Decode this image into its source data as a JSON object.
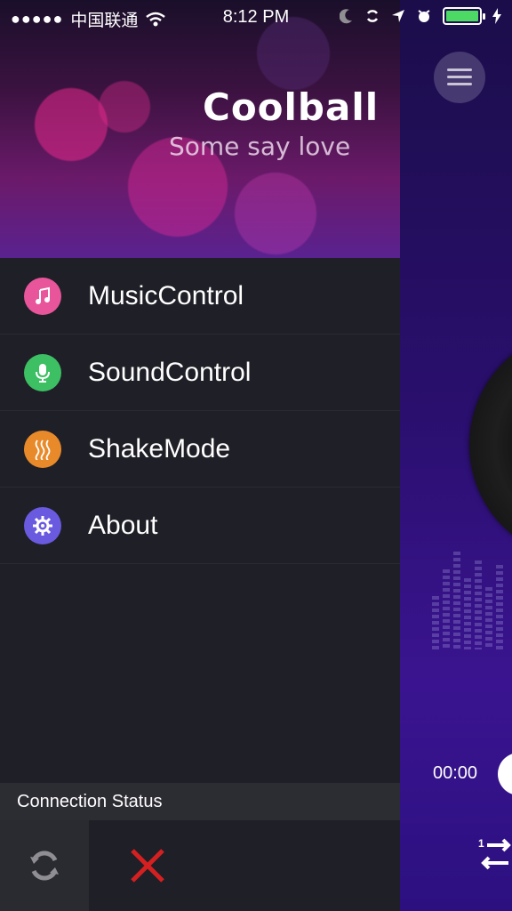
{
  "status_bar": {
    "signal_dots": "●●●●●",
    "carrier": "中国联通",
    "time": "8:12 PM",
    "battery_color": "#4cd964"
  },
  "header": {
    "title": "Coolball",
    "subtitle": "Some say love"
  },
  "menu": {
    "items": [
      {
        "label": "MusicControl",
        "icon": "music-note-icon",
        "color": "#e8559a"
      },
      {
        "label": "SoundControl",
        "icon": "microphone-icon",
        "color": "#3dbf63"
      },
      {
        "label": "ShakeMode",
        "icon": "wave-icon",
        "color": "#e88a2a"
      },
      {
        "label": "About",
        "icon": "gear-icon",
        "color": "#6a5ae0"
      }
    ]
  },
  "connection": {
    "label": "Connection Status",
    "status_color": "#d42020"
  },
  "player": {
    "elapsed": "00:00",
    "repeat_badge": "1"
  }
}
